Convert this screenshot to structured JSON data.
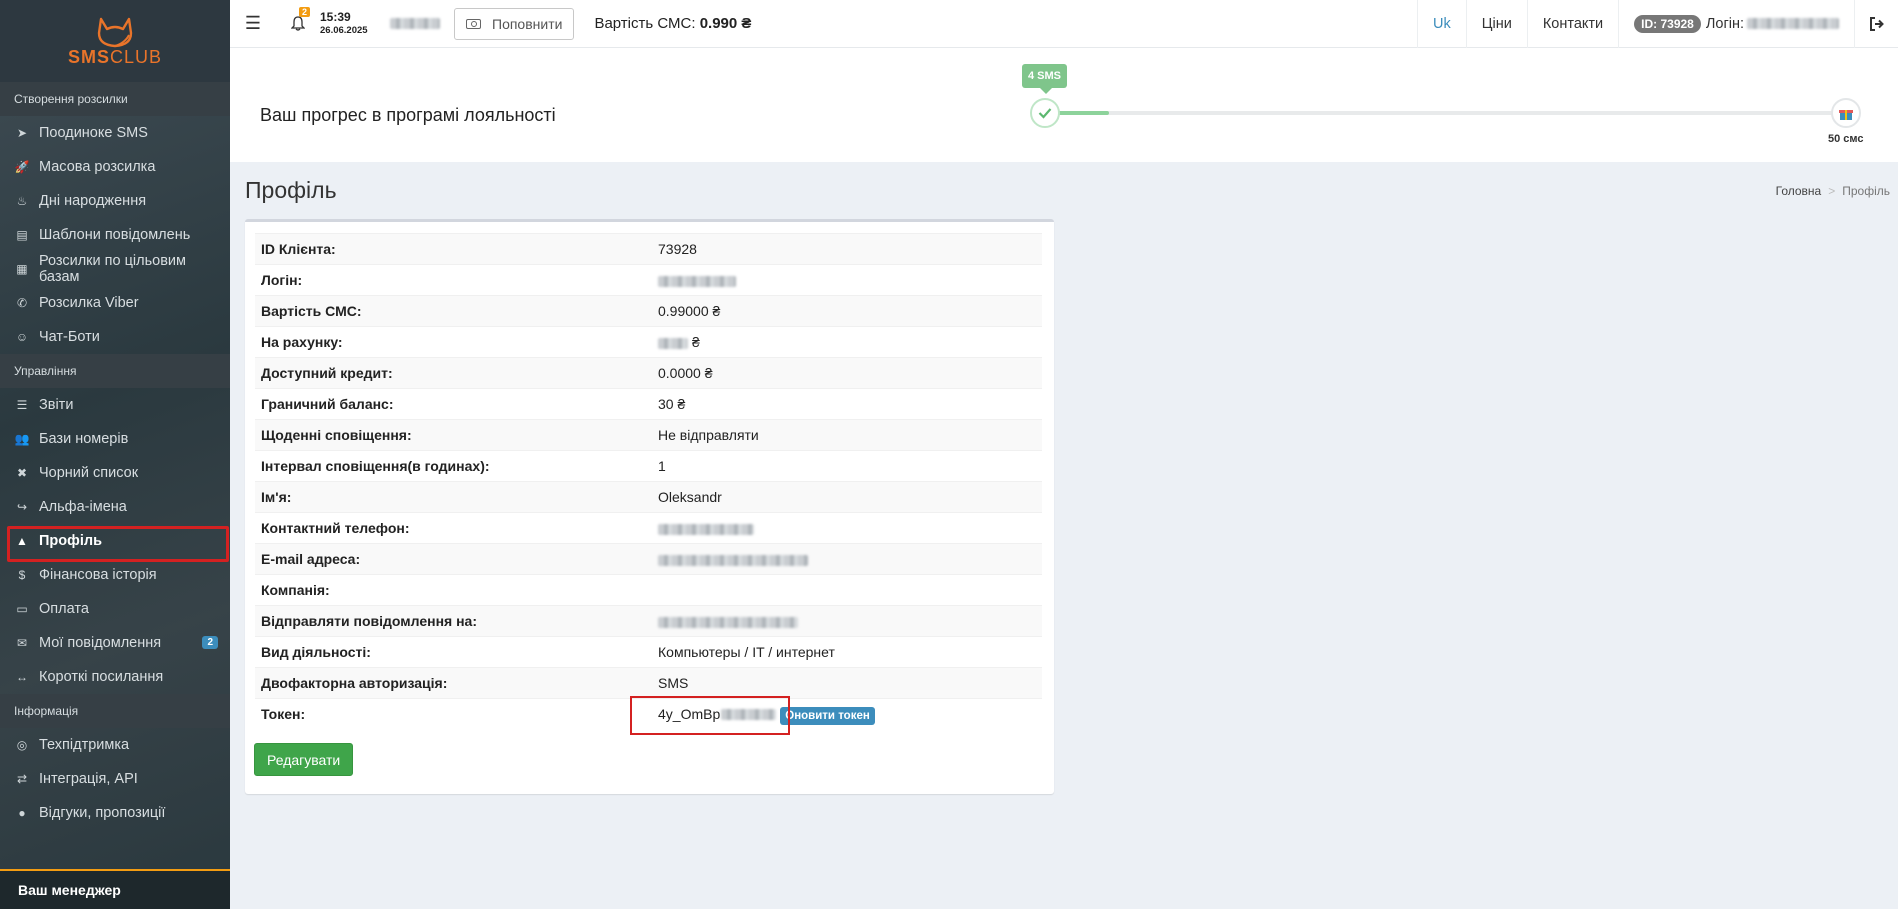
{
  "brand": {
    "logo_main": "SMS",
    "logo_sub": "CLUB"
  },
  "sidebar": {
    "sections": [
      {
        "label": "Створення розсилки",
        "items": [
          {
            "label": "Поодиноке SMS",
            "icon": "paper-plane-icon"
          },
          {
            "label": "Масова розсилка",
            "icon": "rocket-icon"
          },
          {
            "label": "Дні народження",
            "icon": "birthday-cake-icon"
          },
          {
            "label": "Шаблони повідомлень",
            "icon": "file-icon"
          },
          {
            "label": "Розсилки по цільовим базам",
            "icon": "table-icon"
          },
          {
            "label": "Розсилка Viber",
            "icon": "viber-icon"
          },
          {
            "label": "Чат-Боти",
            "icon": "robot-icon"
          }
        ]
      },
      {
        "label": "Управління",
        "items": [
          {
            "label": "Звіти",
            "icon": "list-icon"
          },
          {
            "label": "Бази номерів",
            "icon": "users-icon"
          },
          {
            "label": "Чорний список",
            "icon": "user-block-icon"
          },
          {
            "label": "Альфа-імена",
            "icon": "share-icon"
          },
          {
            "label": "Профіль",
            "icon": "user-icon",
            "active": true
          },
          {
            "label": "Фінансова історія",
            "icon": "dollar-icon"
          },
          {
            "label": "Оплата",
            "icon": "money-icon"
          },
          {
            "label": "Мої повідомлення",
            "icon": "envelope-icon",
            "badge": "2"
          },
          {
            "label": "Короткі посилання",
            "icon": "arrows-h-icon"
          }
        ]
      },
      {
        "label": "Інформація",
        "items": [
          {
            "label": "Техпідтримка",
            "icon": "lifebuoy-icon"
          },
          {
            "label": "Інтеграція, API",
            "icon": "exchange-icon"
          },
          {
            "label": "Відгуки, пропозиції",
            "icon": "comment-icon"
          }
        ]
      }
    ],
    "manager_label": "Ваш менеджер"
  },
  "topbar": {
    "bell_badge": "2",
    "time": "15:39",
    "date": "26.06.2025",
    "topup_label": "Поповнити",
    "sms_cost_label": "Вартість СМС:",
    "sms_cost_value": "0.990 ₴",
    "lang": "Uk",
    "prices": "Ціни",
    "contacts": "Контакти",
    "id_badge": "ID: 73928",
    "login_label": "Логін:"
  },
  "loyalty": {
    "title": "Ваш прогрес в програмі лояльності",
    "current_label": "4 SMS",
    "target_label": "50 смс",
    "progress": 0.08
  },
  "page": {
    "title": "Профіль",
    "breadcrumb": {
      "home": "Головна",
      "current": "Профіль"
    }
  },
  "profile": {
    "rows": [
      {
        "key": "ID Клієнта:",
        "value": "73928"
      },
      {
        "key": "Логін:",
        "value": ""
      },
      {
        "key": "Вартість СМС:",
        "value": "0.99000 ₴"
      },
      {
        "key": "На рахунку:",
        "value": "₴"
      },
      {
        "key": "Доступний кредит:",
        "value": "0.0000 ₴"
      },
      {
        "key": "Граничний баланс:",
        "value": "30 ₴"
      },
      {
        "key": "Щоденні сповіщення:",
        "value": "Не відправляти"
      },
      {
        "key": "Інтервал сповіщення(в годинах):",
        "value": "1"
      },
      {
        "key": "Ім'я:",
        "value": "Oleksandr"
      },
      {
        "key": "Контактний телефон:",
        "value": ""
      },
      {
        "key": "E-mail адреса:",
        "value": ""
      },
      {
        "key": "Компанія:",
        "value": ""
      },
      {
        "key": "Відправляти повідомлення на:",
        "value": ""
      },
      {
        "key": "Вид діяльності:",
        "value": "Компьютеры / IT / интернет"
      },
      {
        "key": "Двофакторна авторизація:",
        "value": "SMS"
      },
      {
        "key": "Токен:",
        "value": "4y_OmBp"
      }
    ],
    "refresh_token_label": "Оновити токен",
    "edit_label": "Редагувати"
  }
}
